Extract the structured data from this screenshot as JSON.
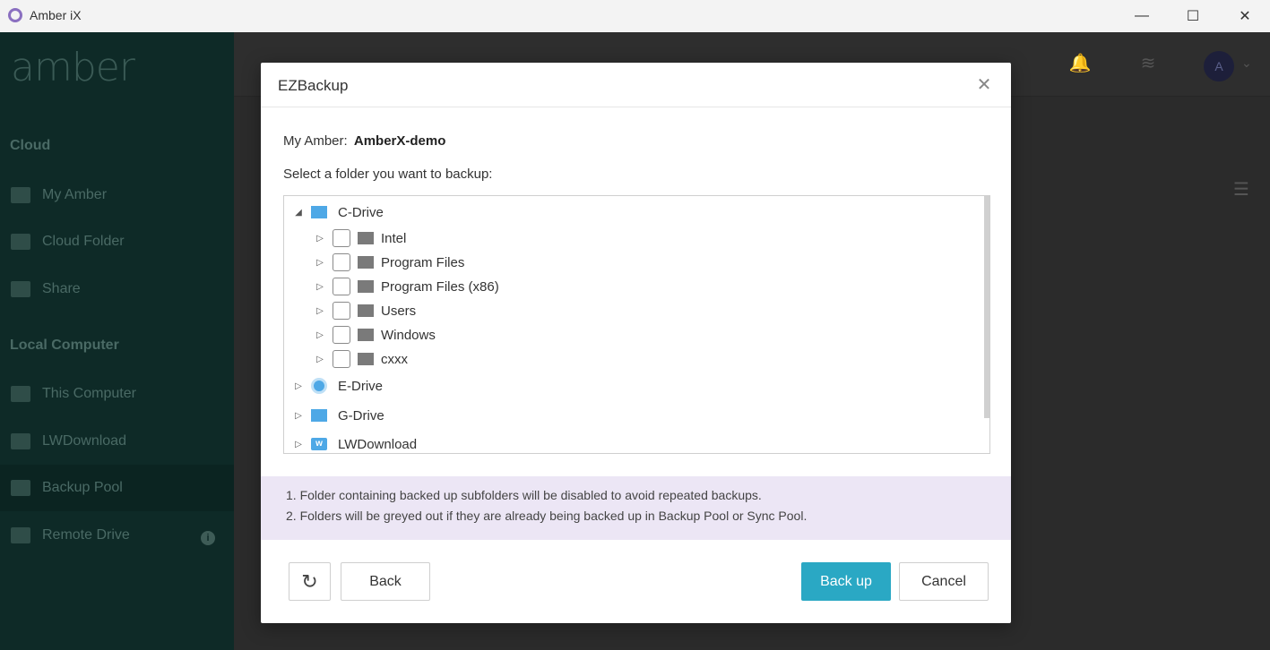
{
  "window": {
    "title": "Amber iX",
    "minimize": "—",
    "maximize": "☐",
    "close": "✕"
  },
  "sidebar": {
    "logo": "amber",
    "sections": [
      {
        "label": "Cloud"
      },
      {
        "label": "Local Computer"
      }
    ],
    "items": [
      {
        "label": "My Amber"
      },
      {
        "label": "Cloud Folder"
      },
      {
        "label": "Share"
      },
      {
        "label": "This Computer"
      },
      {
        "label": "LWDownload"
      },
      {
        "label": "Backup Pool"
      },
      {
        "label": "Remote Drive"
      }
    ]
  },
  "topbar": {
    "avatar_letter": "A"
  },
  "dialog": {
    "title": "EZBackup",
    "my_amber_label": "My Amber:",
    "my_amber_value": "AmberX-demo",
    "select_label": "Select a folder you want to backup:",
    "tree": {
      "root": {
        "label": "C-Drive",
        "expanded": true
      },
      "children": [
        {
          "label": "Intel",
          "checked": false
        },
        {
          "label": "Program Files",
          "checked": false
        },
        {
          "label": "Program Files (x86)",
          "checked": false
        },
        {
          "label": "Users",
          "checked": false
        },
        {
          "label": "Windows",
          "checked": false
        },
        {
          "label": "cxxx",
          "checked": false
        }
      ],
      "drives": [
        {
          "label": "E-Drive"
        },
        {
          "label": "G-Drive"
        },
        {
          "label": "LWDownload"
        }
      ]
    },
    "notes": [
      "1. Folder containing backed up subfolders will be disabled to avoid repeated backups.",
      "2. Folders will be greyed out if they are already being backed up in Backup Pool or Sync Pool."
    ],
    "buttons": {
      "back": "Back",
      "backup": "Back up",
      "cancel": "Cancel"
    }
  },
  "colors": {
    "accent": "#2aa8c4",
    "notes_bg": "#ece6f5",
    "sidebar_bg": "#0e2a27"
  }
}
